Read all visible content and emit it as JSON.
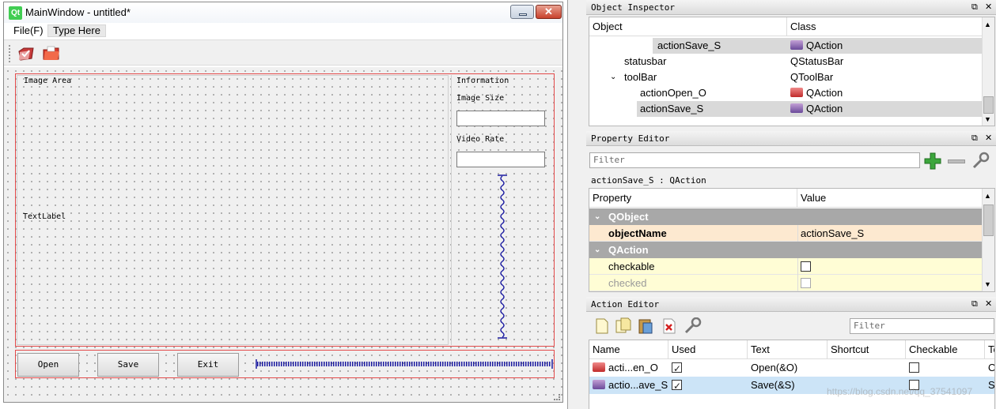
{
  "designer": {
    "window_title": "MainWindow - untitled*",
    "logo_text": "Qt",
    "menu": [
      {
        "label": "File(F)"
      },
      {
        "label": "Type Here"
      }
    ],
    "toolbar_icons": [
      "open-action-icon",
      "save-action-icon"
    ],
    "image_group_title": "Image Area",
    "text_label": "TextLabel",
    "info_group_title": "Information",
    "image_size_label": "Image Size",
    "video_rate_label": "Video Rate",
    "buttons": {
      "open": "Open",
      "save": "Save",
      "exit": "Exit"
    }
  },
  "object_inspector": {
    "title": "Object Inspector",
    "headers": {
      "object": "Object",
      "class": "Class"
    },
    "rows": [
      {
        "object": "actionSave_S",
        "class": "QAction"
      },
      {
        "object": "statusbar",
        "class": "QStatusBar"
      },
      {
        "object": "toolBar",
        "class": "QToolBar"
      },
      {
        "object": "actionOpen_O",
        "class": "QAction"
      },
      {
        "object": "actionSave_S",
        "class": "QAction"
      }
    ]
  },
  "property_editor": {
    "title": "Property Editor",
    "filter_placeholder": "Filter",
    "context": "actionSave_S : QAction",
    "headers": {
      "property": "Property",
      "value": "Value"
    },
    "group_qobject": "QObject",
    "object_name_label": "objectName",
    "object_name_value": "actionSave_S",
    "group_qaction": "QAction",
    "checkable_label": "checkable",
    "checked_label": "checked"
  },
  "action_editor": {
    "title": "Action Editor",
    "filter_placeholder": "Filter",
    "headers": {
      "name": "Name",
      "used": "Used",
      "text": "Text",
      "shortcut": "Shortcut",
      "checkable": "Checkable",
      "tooltip": "To"
    },
    "rows": [
      {
        "name": "acti...en_O",
        "text": "Open(&O)",
        "tooltip": "O"
      },
      {
        "name": "actio...ave_S",
        "text": "Save(&S)",
        "tooltip": "Sa"
      }
    ],
    "watermark": "https://blog.csdn.net/qq_37541097"
  },
  "colors": {
    "layout_red": "#e34a4a",
    "spacer_blue": "#1a1aa0",
    "selection": "#cce4f7"
  }
}
